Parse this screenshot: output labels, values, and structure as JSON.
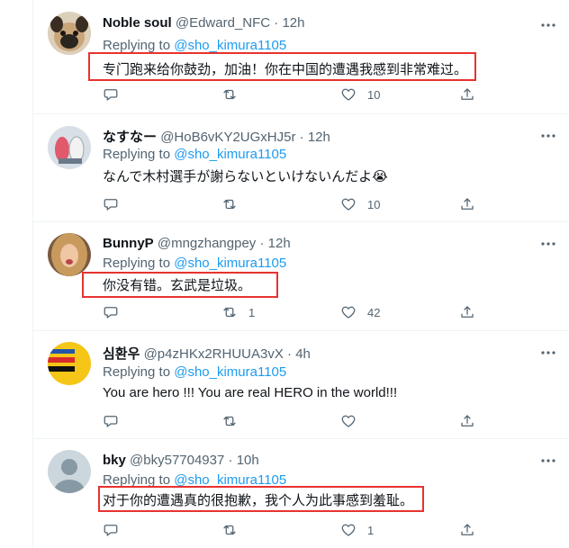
{
  "tweets": [
    {
      "name": "Noble soul",
      "handle": "@Edward_NFC",
      "dot": "·",
      "time": "12h",
      "replying_prefix": "Replying to ",
      "replying_to": "@sho_kimura1105",
      "text": "专门跑来给你鼓劲，加油！你在中国的遭遇我感到非常难过。",
      "retweets": "",
      "likes": "10"
    },
    {
      "name": "なすなー",
      "handle": "@HoB6vKY2UGxHJ5r",
      "dot": "·",
      "time": "12h",
      "replying_prefix": "Replying to ",
      "replying_to": "@sho_kimura1105",
      "text": "なんで木村選手が謝らないといけないんだよ😭",
      "retweets": "",
      "likes": "10"
    },
    {
      "name": "BunnyP",
      "handle": "@mngzhangpey",
      "dot": "·",
      "time": "12h",
      "replying_prefix": "Replying to ",
      "replying_to": "@sho_kimura1105",
      "text": "你没有错。玄武是垃圾。",
      "retweets": "1",
      "likes": "42"
    },
    {
      "name": "심환우",
      "handle": "@p4zHKx2RHUUA3vX",
      "dot": "·",
      "time": "4h",
      "replying_prefix": "Replying to ",
      "replying_to": "@sho_kimura1105",
      "text": "You are hero !!! You are real HERO in the world!!!",
      "retweets": "",
      "likes": ""
    },
    {
      "name": "bky",
      "handle": "@bky57704937",
      "dot": "·",
      "time": "10h",
      "replying_prefix": "Replying to ",
      "replying_to": "@sho_kimura1105",
      "text": "对于你的遭遇真的很抱歉，我个人为此事感到羞耻。",
      "retweets": "",
      "likes": "1"
    }
  ],
  "icons": {
    "more": "more-horizontal-icon",
    "reply": "reply-bubble-icon",
    "retweet": "retweet-icon",
    "like": "heart-icon",
    "share": "share-icon"
  },
  "colors": {
    "link": "#1d9bf0",
    "secondary": "#536471",
    "highlight": "#e8322f"
  }
}
